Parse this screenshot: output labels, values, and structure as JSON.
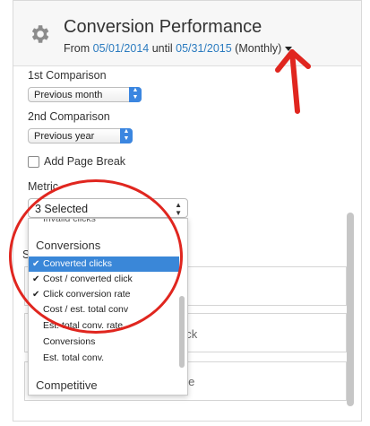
{
  "header": {
    "title": "Conversion Performance",
    "from_label": "From",
    "start_date": "05/01/2014",
    "until_label": "until",
    "end_date": "05/31/2015",
    "period": "(Monthly)"
  },
  "comparison1": {
    "label": "1st Comparison",
    "value": "Previous month"
  },
  "comparison2": {
    "label": "2nd Comparison",
    "value": "Previous year"
  },
  "page_break": {
    "label": "Add Page Break",
    "checked": false
  },
  "metric": {
    "label": "Metric",
    "value": "3 Selected",
    "dropdown": {
      "clipped_item": "Invalid clicks",
      "group_conversions": "Conversions",
      "items": [
        {
          "label": "Converted clicks",
          "checked": true,
          "highlighted": true
        },
        {
          "label": "Cost / converted click",
          "checked": true,
          "highlighted": false
        },
        {
          "label": "Click conversion rate",
          "checked": true,
          "highlighted": false
        },
        {
          "label": "Cost / est. total conv",
          "checked": false,
          "highlighted": false
        },
        {
          "label": "Est. total conv. rate",
          "checked": false,
          "highlighted": false
        },
        {
          "label": "Conversions",
          "checked": false,
          "highlighted": false
        },
        {
          "label": "Est. total conv.",
          "checked": false,
          "highlighted": false
        }
      ],
      "group_competitive": "Competitive"
    }
  },
  "background": {
    "partial_label_s": "S",
    "partial_click": "click",
    "partial_rate": "rate"
  },
  "colors": {
    "accent": "#3a87d8",
    "link": "#2b7bbf",
    "annotation": "#e0261f"
  },
  "icons": {
    "settings": "gear-icon",
    "dropdown": "caret-down-icon"
  }
}
